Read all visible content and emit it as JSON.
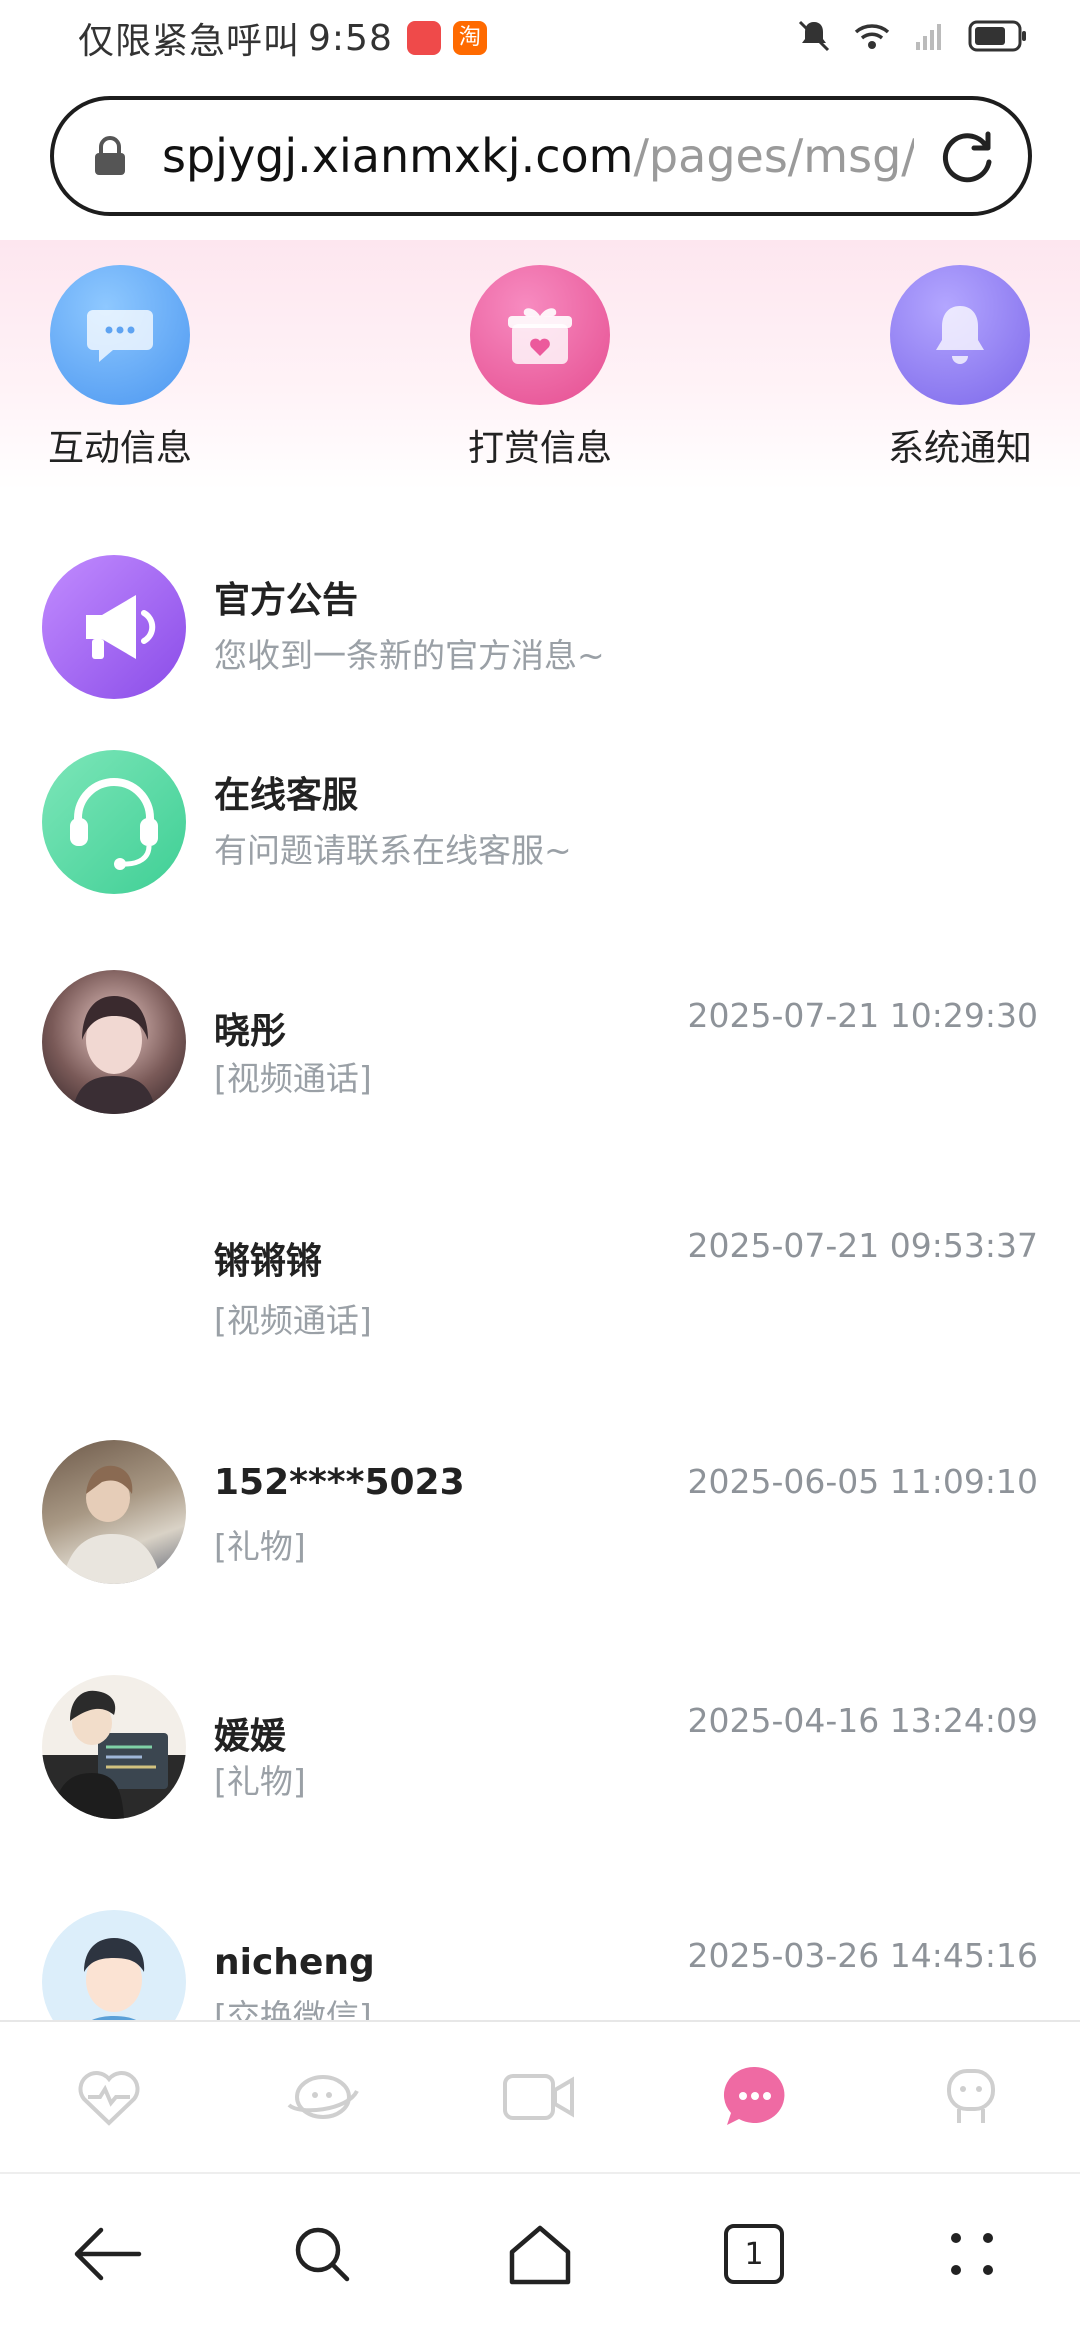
{
  "status_bar": {
    "left_text": "仅限紧急呼叫",
    "time": "9:58",
    "taobao_badge": "淘"
  },
  "browser": {
    "url_host": "spjygj.xianmxkj.com",
    "url_path": "/pages/msg/i"
  },
  "categories": [
    {
      "label": "互动信息",
      "icon": "chat-bubble-icon",
      "color": "#5aa8f5"
    },
    {
      "label": "打赏信息",
      "icon": "gift-icon",
      "color": "#ec5a9c"
    },
    {
      "label": "系统通知",
      "icon": "bell-icon",
      "color": "#8c78f0"
    }
  ],
  "messages": [
    {
      "name": "官方公告",
      "preview": "您收到一条新的官方消息~",
      "time": "",
      "icon": "megaphone-icon"
    },
    {
      "name": "在线客服",
      "preview": "有问题请联系在线客服~",
      "time": "",
      "icon": "headset-icon"
    },
    {
      "name": "晓彤",
      "preview": "[视频通话]",
      "time": "2025-07-21 10:29:30"
    },
    {
      "name": "锵锵锵",
      "preview": "[视频通话]",
      "time": "2025-07-21 09:53:37"
    },
    {
      "name": "152****5023",
      "preview": "[礼物]",
      "time": "2025-06-05 11:09:10"
    },
    {
      "name": "媛媛",
      "preview": "[礼物]",
      "time": "2025-04-16 13:24:09"
    },
    {
      "name": "nicheng",
      "preview": "[交换微信]",
      "time": "2025-03-26 14:45:16"
    }
  ],
  "tabbar": {
    "items": [
      "heart-pulse-icon",
      "planet-icon",
      "video-icon",
      "message-icon",
      "robot-icon"
    ],
    "active_index": 3,
    "active_color": "#ef6aa3"
  },
  "browser_nav": {
    "tab_count": "1"
  }
}
